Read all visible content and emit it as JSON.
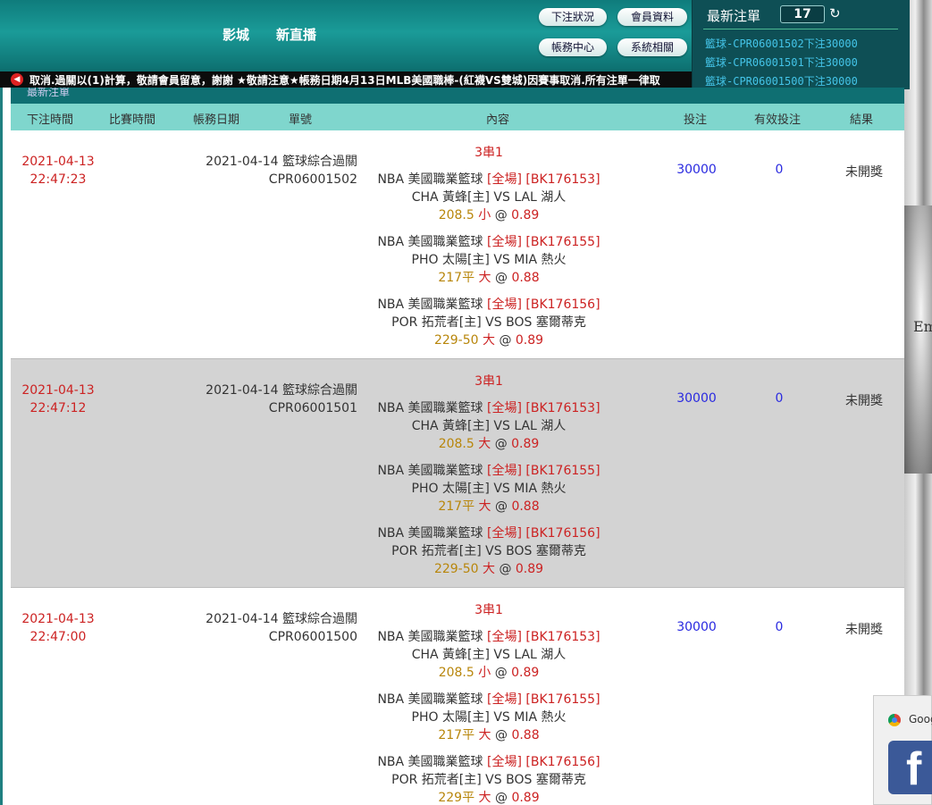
{
  "header": {
    "nav": [
      "影城",
      "新直播"
    ],
    "buttons": {
      "bet_status": "下注狀況",
      "member_info": "會員資料",
      "account_center": "帳務中心",
      "system_related": "系統相關"
    }
  },
  "latest_bets": {
    "title": "最新注單",
    "count": "17",
    "items": [
      "籃球-CPR06001502下注30000",
      "籃球-CPR06001501下注30000",
      "籃球-CPR06001500下注30000"
    ]
  },
  "marquee": {
    "text": "取消.過關以(1)計算，敬請會員留意，謝謝 ★敬請注意★帳務日期4月13日MLB美國職棒-(紅襪VS雙城)因賽事取消.所有注單一律取"
  },
  "section_title": "最新注單",
  "table": {
    "headers": [
      "下注時間",
      "比賽時間",
      "帳務日期",
      "單號",
      "內容",
      "投注",
      "有效投注",
      "結果"
    ],
    "rows": [
      {
        "bet_date": "2021-04-13",
        "bet_time": "22:47:23",
        "account_date": "2021-04-14",
        "type": "籃球綜合過關",
        "order_no": "CPR06001502",
        "parlay": "3串1",
        "legs": [
          {
            "league": "NBA 美國職業籃球",
            "scope": "[全場]",
            "code": "[BK176153]",
            "teams": "CHA 黃蜂[主] VS LAL 湖人",
            "line": "208.5",
            "pick": "小",
            "odds": "0.89"
          },
          {
            "league": "NBA 美國職業籃球",
            "scope": "[全場]",
            "code": "[BK176155]",
            "teams": "PHO 太陽[主] VS MIA 熱火",
            "line": "217平",
            "pick": "大",
            "odds": "0.88"
          },
          {
            "league": "NBA 美國職業籃球",
            "scope": "[全場]",
            "code": "[BK176156]",
            "teams": "POR 拓荒者[主] VS BOS 塞爾蒂克",
            "line": "229-50",
            "pick": "大",
            "odds": "0.89"
          }
        ],
        "stake": "30000",
        "valid": "0",
        "result": "未開獎"
      },
      {
        "bet_date": "2021-04-13",
        "bet_time": "22:47:12",
        "account_date": "2021-04-14",
        "type": "籃球綜合過關",
        "order_no": "CPR06001501",
        "parlay": "3串1",
        "legs": [
          {
            "league": "NBA 美國職業籃球",
            "scope": "[全場]",
            "code": "[BK176153]",
            "teams": "CHA 黃蜂[主] VS LAL 湖人",
            "line": "208.5",
            "pick": "大",
            "odds": "0.89"
          },
          {
            "league": "NBA 美國職業籃球",
            "scope": "[全場]",
            "code": "[BK176155]",
            "teams": "PHO 太陽[主] VS MIA 熱火",
            "line": "217平",
            "pick": "大",
            "odds": "0.88"
          },
          {
            "league": "NBA 美國職業籃球",
            "scope": "[全場]",
            "code": "[BK176156]",
            "teams": "POR 拓荒者[主] VS BOS 塞爾蒂克",
            "line": "229-50",
            "pick": "大",
            "odds": "0.89"
          }
        ],
        "stake": "30000",
        "valid": "0",
        "result": "未開獎"
      },
      {
        "bet_date": "2021-04-13",
        "bet_time": "22:47:00",
        "account_date": "2021-04-14",
        "type": "籃球綜合過關",
        "order_no": "CPR06001500",
        "parlay": "3串1",
        "legs": [
          {
            "league": "NBA 美國職業籃球",
            "scope": "[全場]",
            "code": "[BK176153]",
            "teams": "CHA 黃蜂[主] VS LAL 湖人",
            "line": "208.5",
            "pick": "小",
            "odds": "0.89"
          },
          {
            "league": "NBA 美國職業籃球",
            "scope": "[全場]",
            "code": "[BK176155]",
            "teams": "PHO 太陽[主] VS MIA 熱火",
            "line": "217平",
            "pick": "大",
            "odds": "0.88"
          },
          {
            "league": "NBA 美國職業籃球",
            "scope": "[全場]",
            "code": "[BK176156]",
            "teams": "POR 拓荒者[主] VS BOS 塞爾蒂克",
            "line": "229平",
            "pick": "大",
            "odds": "0.89"
          }
        ],
        "stake": "30000",
        "valid": "0",
        "result": "未開獎"
      }
    ]
  },
  "popup": {
    "text": "Goog",
    "icons": [
      "chrome-icon",
      "facebook-icon"
    ]
  },
  "background_word": "Em",
  "colors": {
    "header_teal": "#1a9b98",
    "panel_dark": "#0e4f55",
    "table_head": "#7fd6cd",
    "alt_row": "#d3d3d3",
    "red": "#cc2222",
    "gold": "#b8860b",
    "blue": "#2a2ae0",
    "link_cyan": "#44c4e8"
  }
}
